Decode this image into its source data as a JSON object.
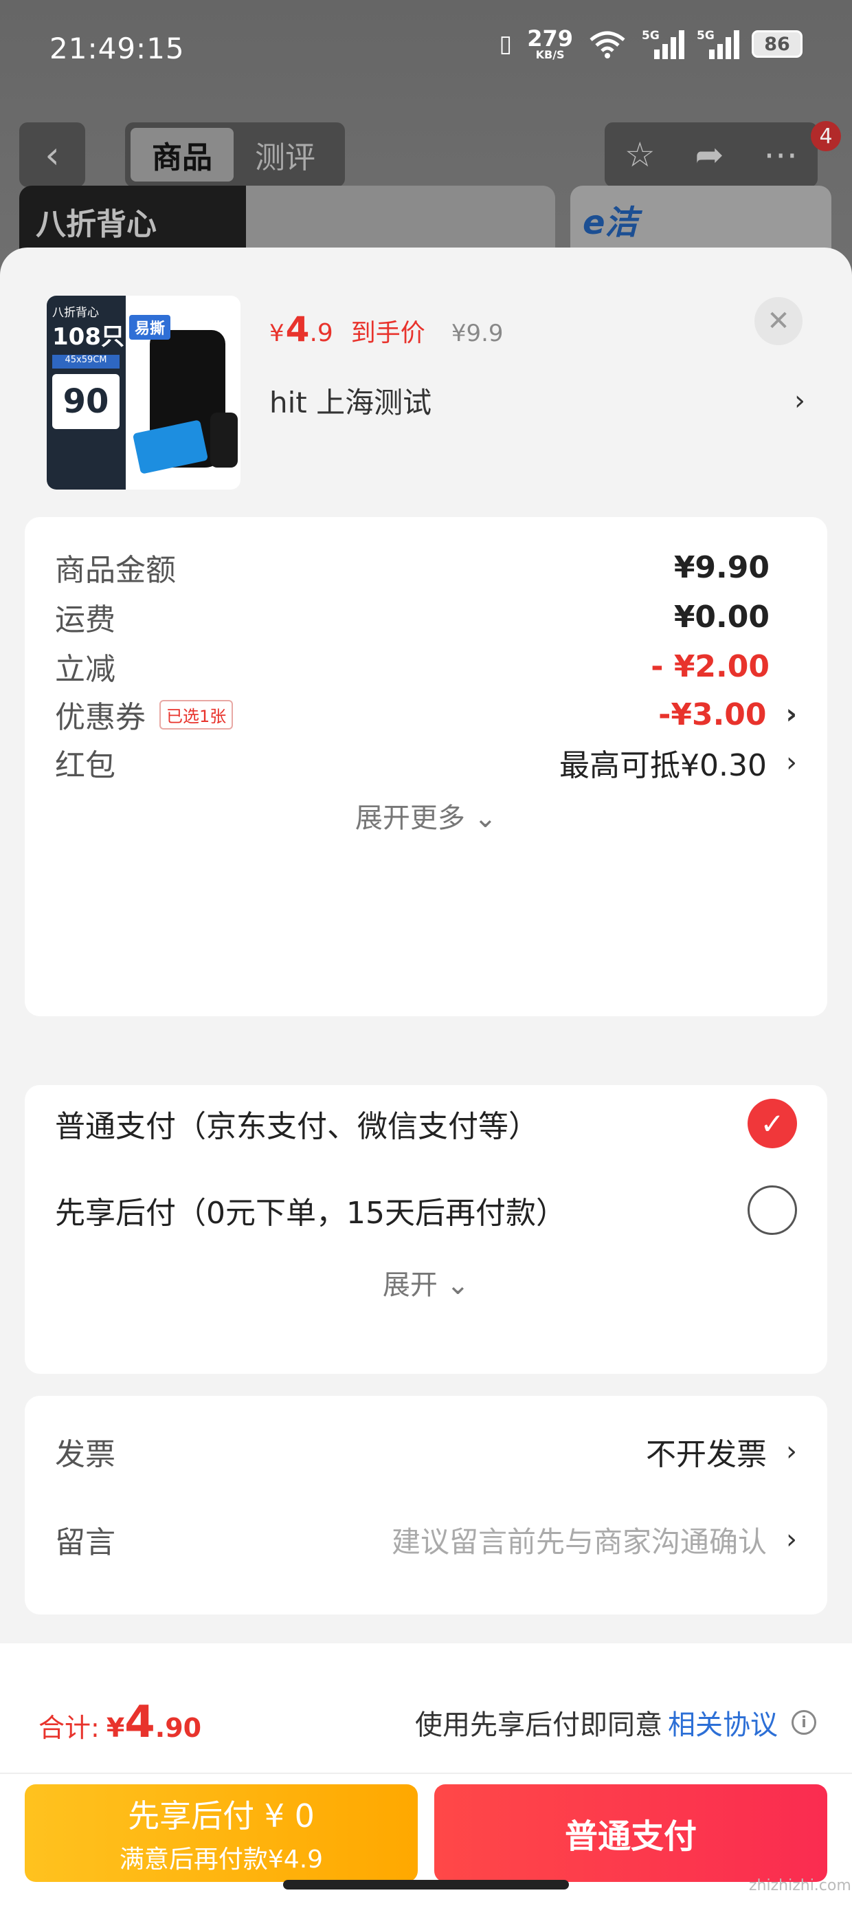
{
  "status_bar": {
    "time": "21:49:15",
    "speed_value": "279",
    "speed_unit": "KB/S",
    "signal_1_tag": "5G",
    "signal_2_tag": "5G",
    "battery": "86",
    "icons": [
      "vibrate-icon",
      "wifi-icon",
      "signal-icon",
      "signal-icon",
      "battery-icon"
    ]
  },
  "top_nav": {
    "tabs": [
      {
        "label": "商品"
      },
      {
        "label": "测评"
      }
    ],
    "active_tab": 0,
    "badge_count": "4",
    "banner_left": "八折背心",
    "banner_right": "e洁"
  },
  "product": {
    "thumb_text": {
      "t1": "八折背心",
      "t2": "108只",
      "t3": "45x59CM",
      "t4": "90",
      "easy": "易撕"
    },
    "price_currency": "¥",
    "price_integer": "4",
    "price_decimal": ".9",
    "price_label": "到手价",
    "original_price": "¥9.9",
    "spec": "hit  上海测试"
  },
  "summary": {
    "rows": [
      {
        "label": "商品金额",
        "value": "¥9.90"
      },
      {
        "label": "运费",
        "value": "¥0.00"
      },
      {
        "label": "立减",
        "value": "- ¥2.00"
      },
      {
        "label": "优惠券",
        "tag": "已选1张",
        "value": "-¥3.00"
      },
      {
        "label": "红包",
        "value": "最高可抵¥0.30"
      }
    ],
    "expand_label": "展开更多"
  },
  "payment": {
    "options": [
      {
        "label": "普通支付（京东支付、微信支付等）",
        "selected": true
      },
      {
        "label": "先享后付（0元下单，15天后再付款）",
        "selected": false
      }
    ],
    "expand_label": "展开"
  },
  "extras": {
    "invoice_label": "发票",
    "invoice_value": "不开发票",
    "message_label": "留言",
    "message_placeholder": "建议留言前先与商家沟通确认"
  },
  "footer": {
    "total_label": "合计:",
    "total_currency": "¥",
    "total_integer": "4",
    "total_decimal": ".90",
    "agreement_text": "使用先享后付即同意",
    "agreement_link": "相关协议",
    "btn_later_line1": "先享后付 ¥ 0",
    "btn_later_line2": "满意后再付款¥4.9",
    "btn_pay": "普通支付"
  },
  "watermark": "zhizhizhi.com",
  "colors": {
    "accent": "#e8332c",
    "pay_button": "#fa2c50",
    "later_button": "#ffb20f",
    "link": "#2c6fd6"
  }
}
